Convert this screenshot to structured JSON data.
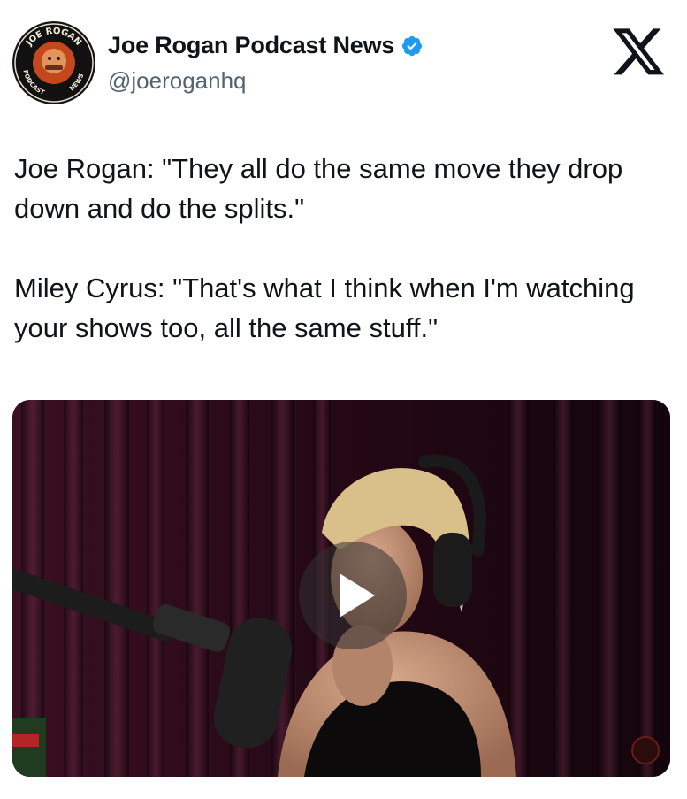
{
  "account": {
    "display_name": "Joe Rogan Podcast News",
    "handle": "@joeroganhq",
    "avatar_text_top": "JOE ROGAN",
    "avatar_text_left": "PODCAST",
    "avatar_text_right": "NEWS",
    "verified_icon": "verified-badge-icon",
    "verified_color": "#1d9bf0"
  },
  "platform": {
    "logo_icon": "x-logo-icon"
  },
  "tweet": {
    "paragraph_1": "Joe Rogan: \"They all do the same move they drop down and do the splits.\"",
    "paragraph_2": "Miley Cyrus: \"That's what I think when I'm watching your shows too, all the same stuff.\""
  },
  "media": {
    "type": "video",
    "play_icon": "play-icon"
  }
}
